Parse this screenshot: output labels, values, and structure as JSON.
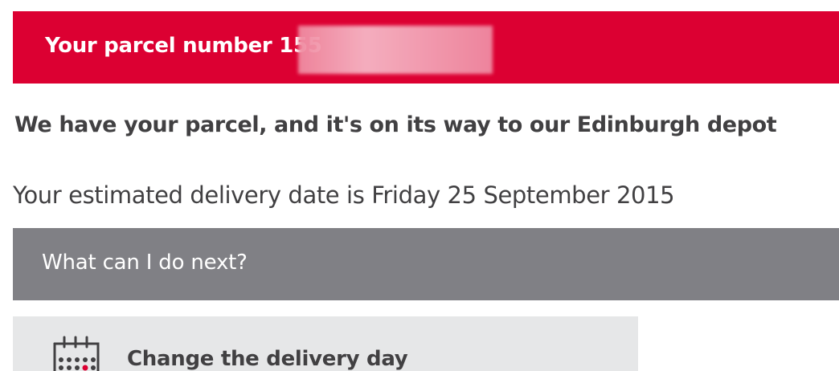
{
  "parcel": {
    "title_prefix": "Your parcel number 155"
  },
  "status": {
    "message": "We have your parcel, and it's on its way to our Edinburgh depot",
    "estimated_delivery": "Your estimated delivery date is Friday 25 September 2015"
  },
  "next_steps": {
    "heading": "What can I do next?",
    "options": [
      {
        "label": "Change the delivery day",
        "icon": "calendar-icon"
      }
    ]
  },
  "colors": {
    "brand_red": "#dc0032",
    "section_gray": "#808085",
    "card_gray": "#e6e7e8",
    "text_dark": "#414042"
  }
}
